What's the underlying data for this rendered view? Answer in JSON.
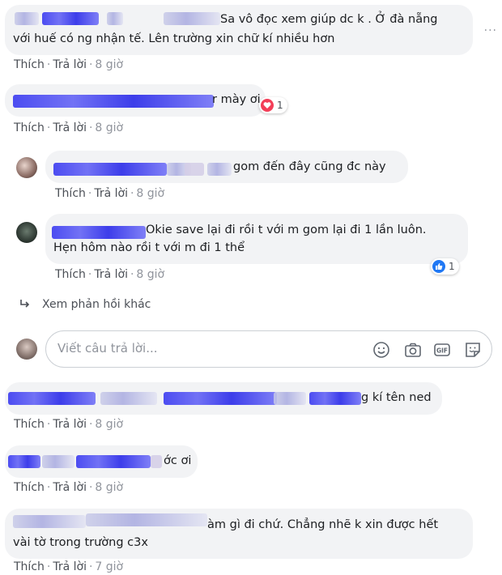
{
  "actions": {
    "like": "Thích",
    "reply": "Trả lời",
    "sep": "·"
  },
  "comments": [
    {
      "text": "Sa vô đọc xem giúp dc k . Ở đà nẵng",
      "text2": "với huế có ng nhận tế. Lên trường xin chữ kí nhiều hơn",
      "time": "8 giờ"
    },
    {
      "text": "r mày ơi",
      "time": "8 giờ",
      "reaction": {
        "type": "love",
        "count": "1",
        "color": "#f33e58"
      }
    },
    {
      "text": "gom đến đây cũng đc này",
      "time": "8 giờ"
    },
    {
      "text": "Okie save lại đi rồi t với m gom lại đi 1 lần luôn.",
      "text2": "Hẹn hôm nào rồi t với m đi 1 thể",
      "time": "8 giờ",
      "reaction": {
        "type": "like",
        "count": "1",
        "color": "#2078f4"
      }
    },
    {
      "text": "g kí tên ned",
      "time": "8 giờ"
    },
    {
      "text": "ớc ơi",
      "time": "8 giờ"
    },
    {
      "text": "àm gì đi chứ. Chẳng nhẽ k xin được hết",
      "text2": "vài tờ trong trường c3x",
      "time": "7 giờ"
    }
  ],
  "see_more": "Xem phản hồi khác",
  "reply_box": {
    "placeholder": "Viết câu trả lời...",
    "tools": [
      "emoji-icon",
      "camera-icon",
      "gif-icon",
      "sticker-icon"
    ]
  },
  "more_menu": "···"
}
